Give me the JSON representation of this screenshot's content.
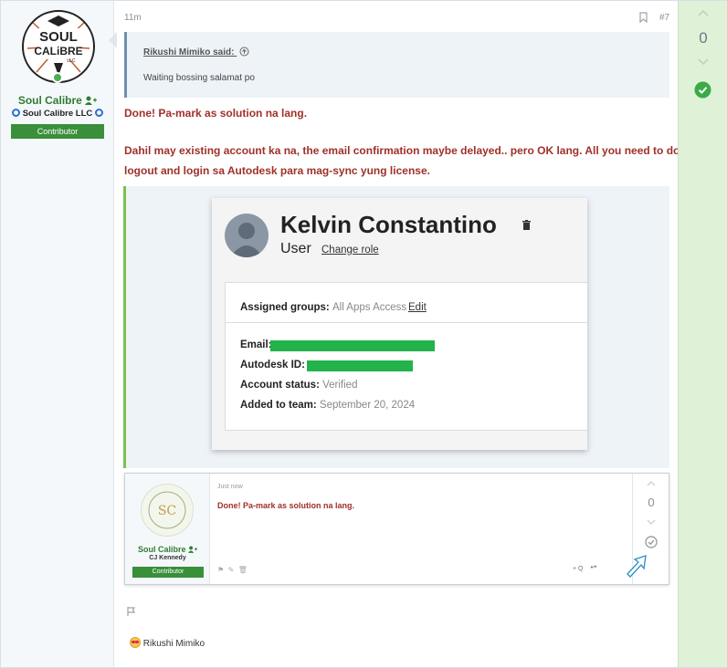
{
  "user": {
    "name": "Soul Calibre",
    "title": "Soul Calibre LLC",
    "banner": "Contributor",
    "avatar_text_1": "SOUL",
    "avatar_text_2": "CALiBRE",
    "avatar_text_3": "LLC"
  },
  "post": {
    "time": "11m",
    "number": "#7",
    "quote": {
      "author": "Rikushi Mimiko said:",
      "text": "Waiting bossing salamat po"
    },
    "message_line1": "Done! Pa-mark as solution na lang.",
    "message_line2": "Dahil may existing account ka na, the email confirmation maybe delayed.. pero OK lang. All you need to do is to",
    "message_line3": "logout and login sa Autodesk para mag-sync yung license."
  },
  "screenshot1": {
    "name": "Kelvin Constantino",
    "role": "User",
    "change_role": "Change role",
    "assigned_groups_label": "Assigned groups:",
    "assigned_groups_value": "All Apps Access",
    "edit": "Edit",
    "email_label": "Email:",
    "autodesk_id_label": "Autodesk ID:",
    "account_status_label": "Account status:",
    "account_status_value": "Verified",
    "added_label": "Added to team:",
    "added_value": "September 20, 2024",
    "redaction_color": "#22b34a"
  },
  "screenshot2": {
    "time": "Just now",
    "message": "Done! Pa-mark as solution na lang.",
    "user_name": "Soul Calibre",
    "user_title": "CJ Kennedy",
    "banner": "Contributor",
    "vote_count": "0",
    "action_quote": "+ Q",
    "action_reply": "❝❞"
  },
  "reaction": {
    "user": "Rikushi Mimiko"
  },
  "votes": {
    "count": "0",
    "accent": "#3bab4a"
  }
}
